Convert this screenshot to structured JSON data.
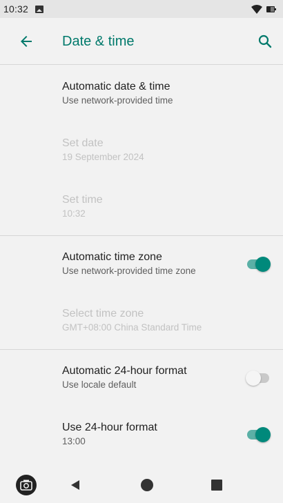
{
  "status_bar": {
    "time": "10:32"
  },
  "app_bar": {
    "title": "Date & time"
  },
  "settings": [
    {
      "title": "Automatic date & time",
      "summary": "Use network-provided time",
      "enabled": true
    },
    {
      "title": "Set date",
      "summary": "19 September 2024",
      "enabled": false
    },
    {
      "title": "Set time",
      "summary": "10:32",
      "enabled": false
    },
    {
      "title": "Automatic time zone",
      "summary": "Use network-provided time zone",
      "enabled": true,
      "toggle": "on"
    },
    {
      "title": "Select time zone",
      "summary": "GMT+08:00 China Standard Time",
      "enabled": false
    },
    {
      "title": "Automatic 24-hour format",
      "summary": "Use locale default",
      "enabled": true,
      "toggle": "off"
    },
    {
      "title": "Use 24-hour format",
      "summary": "13:00",
      "enabled": true,
      "toggle": "on"
    }
  ],
  "colors": {
    "accent": "#00796b",
    "toggle_on": "#00897b",
    "toggle_off": "#f5f5f5",
    "disabled_text": "#c2c2c2"
  },
  "icons": {
    "back": "arrow-left-icon",
    "search": "search-icon",
    "wifi": "wifi-icon",
    "battery": "battery-icon",
    "camera": "camera-icon"
  }
}
